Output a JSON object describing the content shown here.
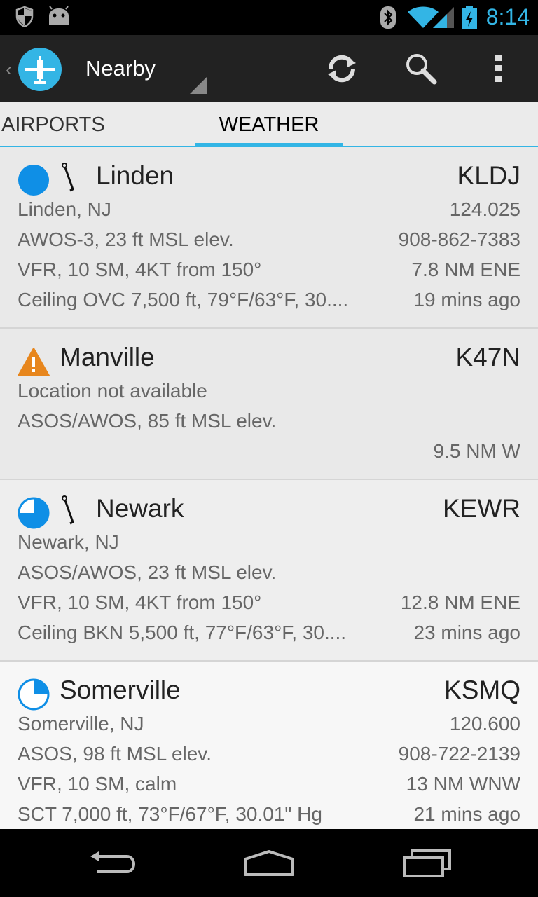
{
  "status_bar": {
    "time": "8:14",
    "icons": [
      "shield-icon",
      "android-icon",
      "bluetooth-icon",
      "wifi-icon",
      "signal-icon",
      "battery-charging-icon"
    ],
    "accent": "#33b5e5"
  },
  "action_bar": {
    "title": "Nearby",
    "actions": [
      "refresh-icon",
      "search-icon",
      "overflow-menu-icon"
    ]
  },
  "tabs": [
    {
      "label": "AIRPORTS",
      "selected": false
    },
    {
      "label": "WEATHER",
      "selected": true
    }
  ],
  "stations": [
    {
      "name": "Linden",
      "code": "KLDJ",
      "category_icon": "vfr-full-circle-icon",
      "wind_icon": true,
      "rows": [
        {
          "left": "Linden, NJ",
          "right": "124.025"
        },
        {
          "left": "AWOS-3, 23 ft MSL elev.",
          "right": "908-862-7383"
        },
        {
          "left": "VFR, 10 SM, 4KT from 150°",
          "right": "7.8 NM ENE"
        },
        {
          "left": "Ceiling OVC 7,500 ft, 79°F/63°F, 30....",
          "right": "19 mins ago"
        }
      ]
    },
    {
      "name": "Manville",
      "code": "K47N",
      "category_icon": "warning-icon",
      "wind_icon": false,
      "rows": [
        {
          "left": "Location not available",
          "right": ""
        },
        {
          "left": "ASOS/AWOS, 85 ft MSL elev.",
          "right": ""
        },
        {
          "left": "",
          "right": "9.5 NM W"
        }
      ]
    },
    {
      "name": "Newark",
      "code": "KEWR",
      "category_icon": "vfr-three-quarter-circle-icon",
      "wind_icon": true,
      "rows": [
        {
          "left": "Newark, NJ",
          "right": ""
        },
        {
          "left": "ASOS/AWOS, 23 ft MSL elev.",
          "right": ""
        },
        {
          "left": "VFR, 10 SM, 4KT from 150°",
          "right": "12.8 NM ENE"
        },
        {
          "left": "Ceiling BKN 5,500 ft, 77°F/63°F, 30....",
          "right": "23 mins ago"
        }
      ]
    },
    {
      "name": "Somerville",
      "code": "KSMQ",
      "category_icon": "vfr-quarter-circle-icon",
      "wind_icon": false,
      "rows": [
        {
          "left": "Somerville, NJ",
          "right": "120.600"
        },
        {
          "left": "ASOS, 98 ft MSL elev.",
          "right": "908-722-2139"
        },
        {
          "left": "VFR, 10 SM, calm",
          "right": "13 NM WNW"
        },
        {
          "left": "SCT 7,000 ft, 73°F/67°F, 30.01\" Hg",
          "right": "21 mins ago"
        }
      ]
    }
  ],
  "nav_bar": [
    "back-icon",
    "home-icon",
    "recents-icon"
  ]
}
